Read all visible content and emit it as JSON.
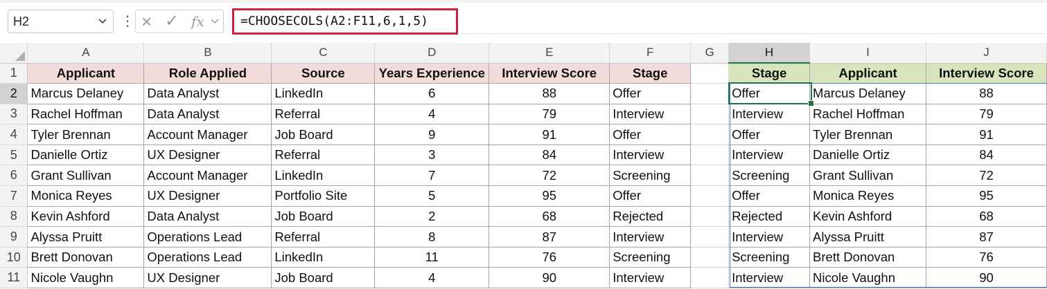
{
  "name_box": "H2",
  "formula": "=CHOOSECOLS(A2:F11,6,1,5)",
  "icons": {
    "cancel": "×",
    "enter": "✓",
    "fx": "fx"
  },
  "columns": [
    "A",
    "B",
    "C",
    "D",
    "E",
    "F",
    "G",
    "H",
    "I",
    "J"
  ],
  "rows": [
    "1",
    "2",
    "3",
    "4",
    "5",
    "6",
    "7",
    "8",
    "9",
    "10",
    "11"
  ],
  "table_headers": [
    "Applicant",
    "Role Applied",
    "Source",
    "Years Experience",
    "Interview Score",
    "Stage"
  ],
  "table_rows": [
    [
      "Marcus Delaney",
      "Data Analyst",
      "LinkedIn",
      "6",
      "88",
      "Offer"
    ],
    [
      "Rachel Hoffman",
      "Data Analyst",
      "Referral",
      "4",
      "79",
      "Interview"
    ],
    [
      "Tyler Brennan",
      "Account Manager",
      "Job Board",
      "9",
      "91",
      "Offer"
    ],
    [
      "Danielle Ortiz",
      "UX Designer",
      "Referral",
      "3",
      "84",
      "Interview"
    ],
    [
      "Grant Sullivan",
      "Account Manager",
      "LinkedIn",
      "7",
      "72",
      "Screening"
    ],
    [
      "Monica Reyes",
      "UX Designer",
      "Portfolio Site",
      "5",
      "95",
      "Offer"
    ],
    [
      "Kevin Ashford",
      "Data Analyst",
      "Job Board",
      "2",
      "68",
      "Rejected"
    ],
    [
      "Alyssa Pruitt",
      "Operations Lead",
      "Referral",
      "8",
      "87",
      "Interview"
    ],
    [
      "Brett Donovan",
      "Operations Lead",
      "LinkedIn",
      "11",
      "76",
      "Screening"
    ],
    [
      "Nicole Vaughn",
      "UX Designer",
      "Job Board",
      "4",
      "90",
      "Interview"
    ]
  ],
  "result_headers": [
    "Stage",
    "Applicant",
    "Interview Score"
  ],
  "result_rows": [
    [
      "Offer",
      "Marcus Delaney",
      "88"
    ],
    [
      "Interview",
      "Rachel Hoffman",
      "79"
    ],
    [
      "Offer",
      "Tyler Brennan",
      "91"
    ],
    [
      "Interview",
      "Danielle Ortiz",
      "84"
    ],
    [
      "Screening",
      "Grant Sullivan",
      "72"
    ],
    [
      "Offer",
      "Monica Reyes",
      "95"
    ],
    [
      "Rejected",
      "Kevin Ashford",
      "68"
    ],
    [
      "Interview",
      "Alyssa Pruitt",
      "87"
    ],
    [
      "Screening",
      "Brett Donovan",
      "76"
    ],
    [
      "Interview",
      "Nicole Vaughn",
      "90"
    ]
  ],
  "colors": {
    "table_header_fill": "#f2dcdb",
    "result_header_fill": "#d8e4bc",
    "formula_highlight": "#d21f3c",
    "active_cell": "#217346",
    "spill_border": "#3b78d8"
  }
}
